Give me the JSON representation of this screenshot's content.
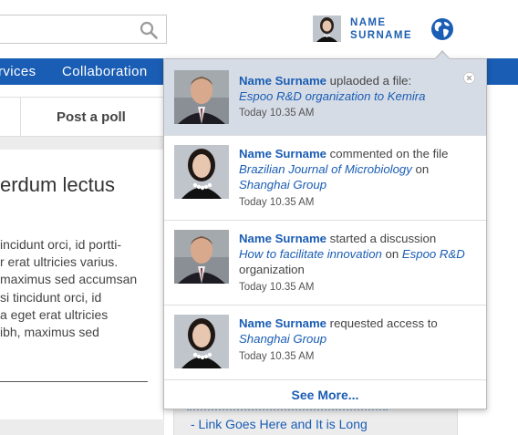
{
  "header": {
    "user_name_line1": "NAME",
    "user_name_line2": "SURNAME"
  },
  "nav": {
    "items": [
      "rvices",
      "Collaboration"
    ]
  },
  "actionbar": {
    "post_poll": "Post a poll"
  },
  "article": {
    "title": "erdum lectus",
    "lines": [
      "incidunt orci, id portti-",
      "r erat ultricies varius.",
      "maximus sed accumsan",
      "si tincidunt orci, id",
      "a eget erat ultricies",
      "ibh, maximus sed"
    ]
  },
  "sidebar": {
    "link": "- Link Goes Here and It is Long"
  },
  "notifications": {
    "items": [
      {
        "name": "Name Surname",
        "action": " uplaoded a file:",
        "link1": "Espoo R&D organization to Kemira",
        "time": "Today 10.35 AM"
      },
      {
        "name": "Name Surname",
        "action": " commented on the file",
        "link1": "Brazilian Journal of Microbiology",
        "connector": " on",
        "link2": "Shanghai Group",
        "time": "Today 10.35 AM"
      },
      {
        "name": "Name Surname",
        "action": " started a discussion",
        "link1": "How to facilitate innovation",
        "connector": " on ",
        "link2": "Espoo R&D",
        "tail": " organization",
        "time": "Today 10.35 AM"
      },
      {
        "name": "Name Surname",
        "action": " requested access to",
        "link1": "Shanghai Group",
        "time": "Today 10.35 AM"
      }
    ],
    "see_more": "See More..."
  },
  "colors": {
    "brand_blue": "#1a5db4",
    "highlight_row": "#d6dce6"
  },
  "icons": [
    "search-icon",
    "globe-icon",
    "close-icon"
  ]
}
